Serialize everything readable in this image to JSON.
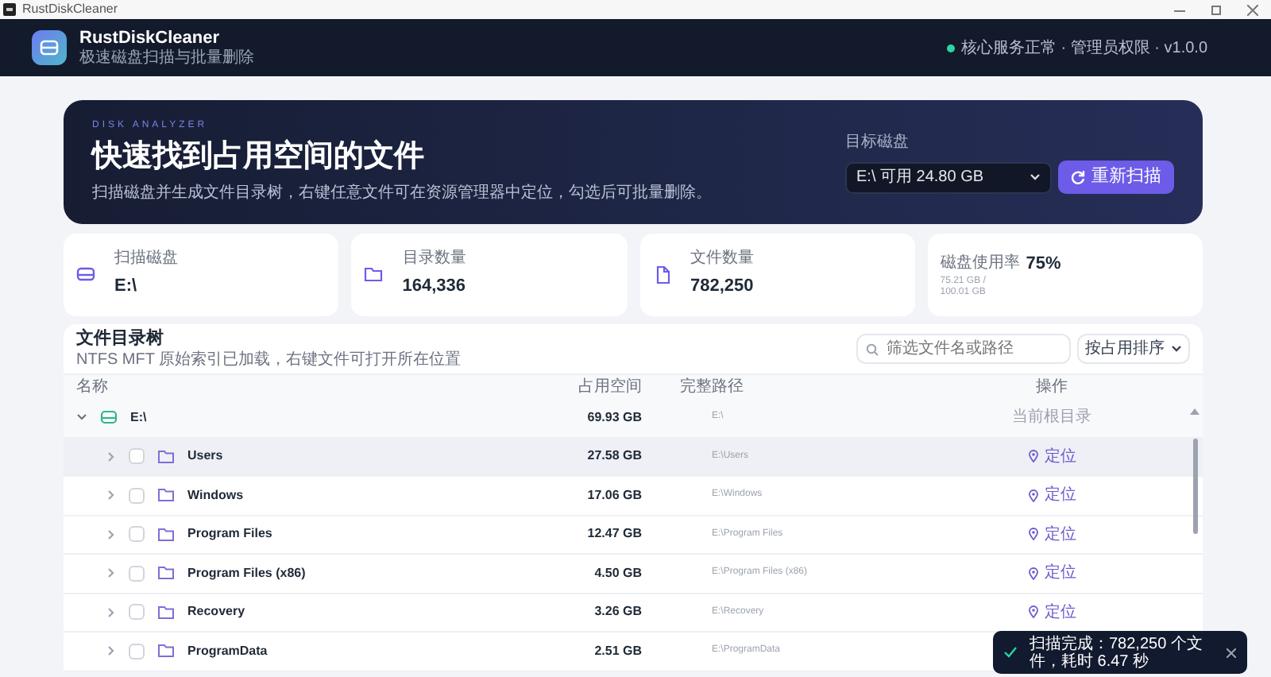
{
  "window": {
    "title": "RustDiskCleaner"
  },
  "header": {
    "app_name": "RustDiskCleaner",
    "subtitle": "极速磁盘扫描与批量删除",
    "status": "核心服务正常 · 管理员权限 · v1.0.0",
    "status_ok": true
  },
  "hero": {
    "eyebrow": "DISK ANALYZER",
    "title": "快速找到占用空间的文件",
    "description": "扫描磁盘并生成文件目录树，右键任意文件可在资源管理器中定位，勾选后可批量删除。",
    "disk_label": "目标磁盘",
    "disk_value": "E:\\  可用 24.80 GB",
    "rescan_button": "重新扫描"
  },
  "stats": [
    {
      "kind": "disk",
      "label": "扫描磁盘",
      "value": "E:\\"
    },
    {
      "kind": "folders",
      "label": "目录数量",
      "value": "164,336"
    },
    {
      "kind": "files",
      "label": "文件数量",
      "value": "782,250"
    },
    {
      "kind": "usage",
      "label": "磁盘使用率",
      "value": "75%",
      "detail": "75.21 GB / 100.01 GB"
    }
  ],
  "tree": {
    "title": "文件目录树",
    "subtitle": "NTFS MFT 原始索引已加载，右键文件可打开所在位置",
    "search": {
      "placeholder": "筛选文件名或路径"
    },
    "sort": "按占用排序",
    "columns": [
      "名称",
      "占用空间",
      "完整路径",
      "操作"
    ],
    "rows": [
      {
        "kind": "drive",
        "name": "E:\\",
        "size": "69.93 GB",
        "path": "E:\\",
        "action": "当前根目录",
        "expanded": true,
        "children": [
          {
            "kind": "folder",
            "name": "Users",
            "size": "27.58 GB",
            "path": "E:\\Users",
            "action": "定位",
            "expanded": false,
            "checked": false,
            "selected": true
          },
          {
            "kind": "folder",
            "name": "Windows",
            "size": "17.06 GB",
            "path": "E:\\Windows",
            "action": "定位",
            "expanded": false,
            "checked": false,
            "selected": false
          },
          {
            "kind": "folder",
            "name": "Program Files",
            "size": "12.47 GB",
            "path": "E:\\Program Files",
            "action": "定位",
            "expanded": false,
            "checked": false,
            "selected": false
          },
          {
            "kind": "folder",
            "name": "Program Files (x86)",
            "size": "4.50 GB",
            "path": "E:\\Program Files (x86)",
            "action": "定位",
            "expanded": false,
            "checked": false,
            "selected": false
          },
          {
            "kind": "folder",
            "name": "Recovery",
            "size": "3.26 GB",
            "path": "E:\\Recovery",
            "action": "定位",
            "expanded": false,
            "checked": false,
            "selected": false
          },
          {
            "kind": "folder",
            "name": "ProgramData",
            "size": "2.51 GB",
            "path": "E:\\ProgramData",
            "expanded": false,
            "checked": false,
            "selected": false
          }
        ]
      }
    ]
  },
  "toast": {
    "message": "扫描完成：782,250 个文件，耗时 6.47 秒"
  }
}
